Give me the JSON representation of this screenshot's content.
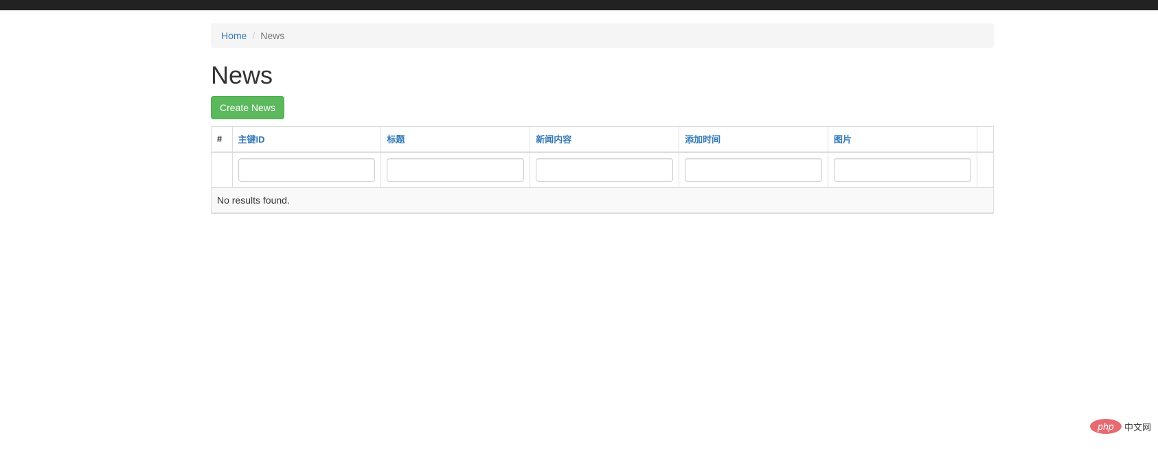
{
  "breadcrumb": {
    "home": "Home",
    "separator": "/",
    "current": "News"
  },
  "page": {
    "title": "News",
    "create_button": "Create News"
  },
  "grid": {
    "columns": [
      "#",
      "主键ID",
      "标题",
      "新闻内容",
      "添加时间",
      "图片"
    ],
    "empty_message": "No results found."
  },
  "watermark": {
    "logo_text": "php",
    "site_text": "中文网"
  },
  "colors": {
    "topbar": "#222222",
    "link": "#337ab7",
    "success": "#5cb85c",
    "logo": "#e66a70"
  }
}
